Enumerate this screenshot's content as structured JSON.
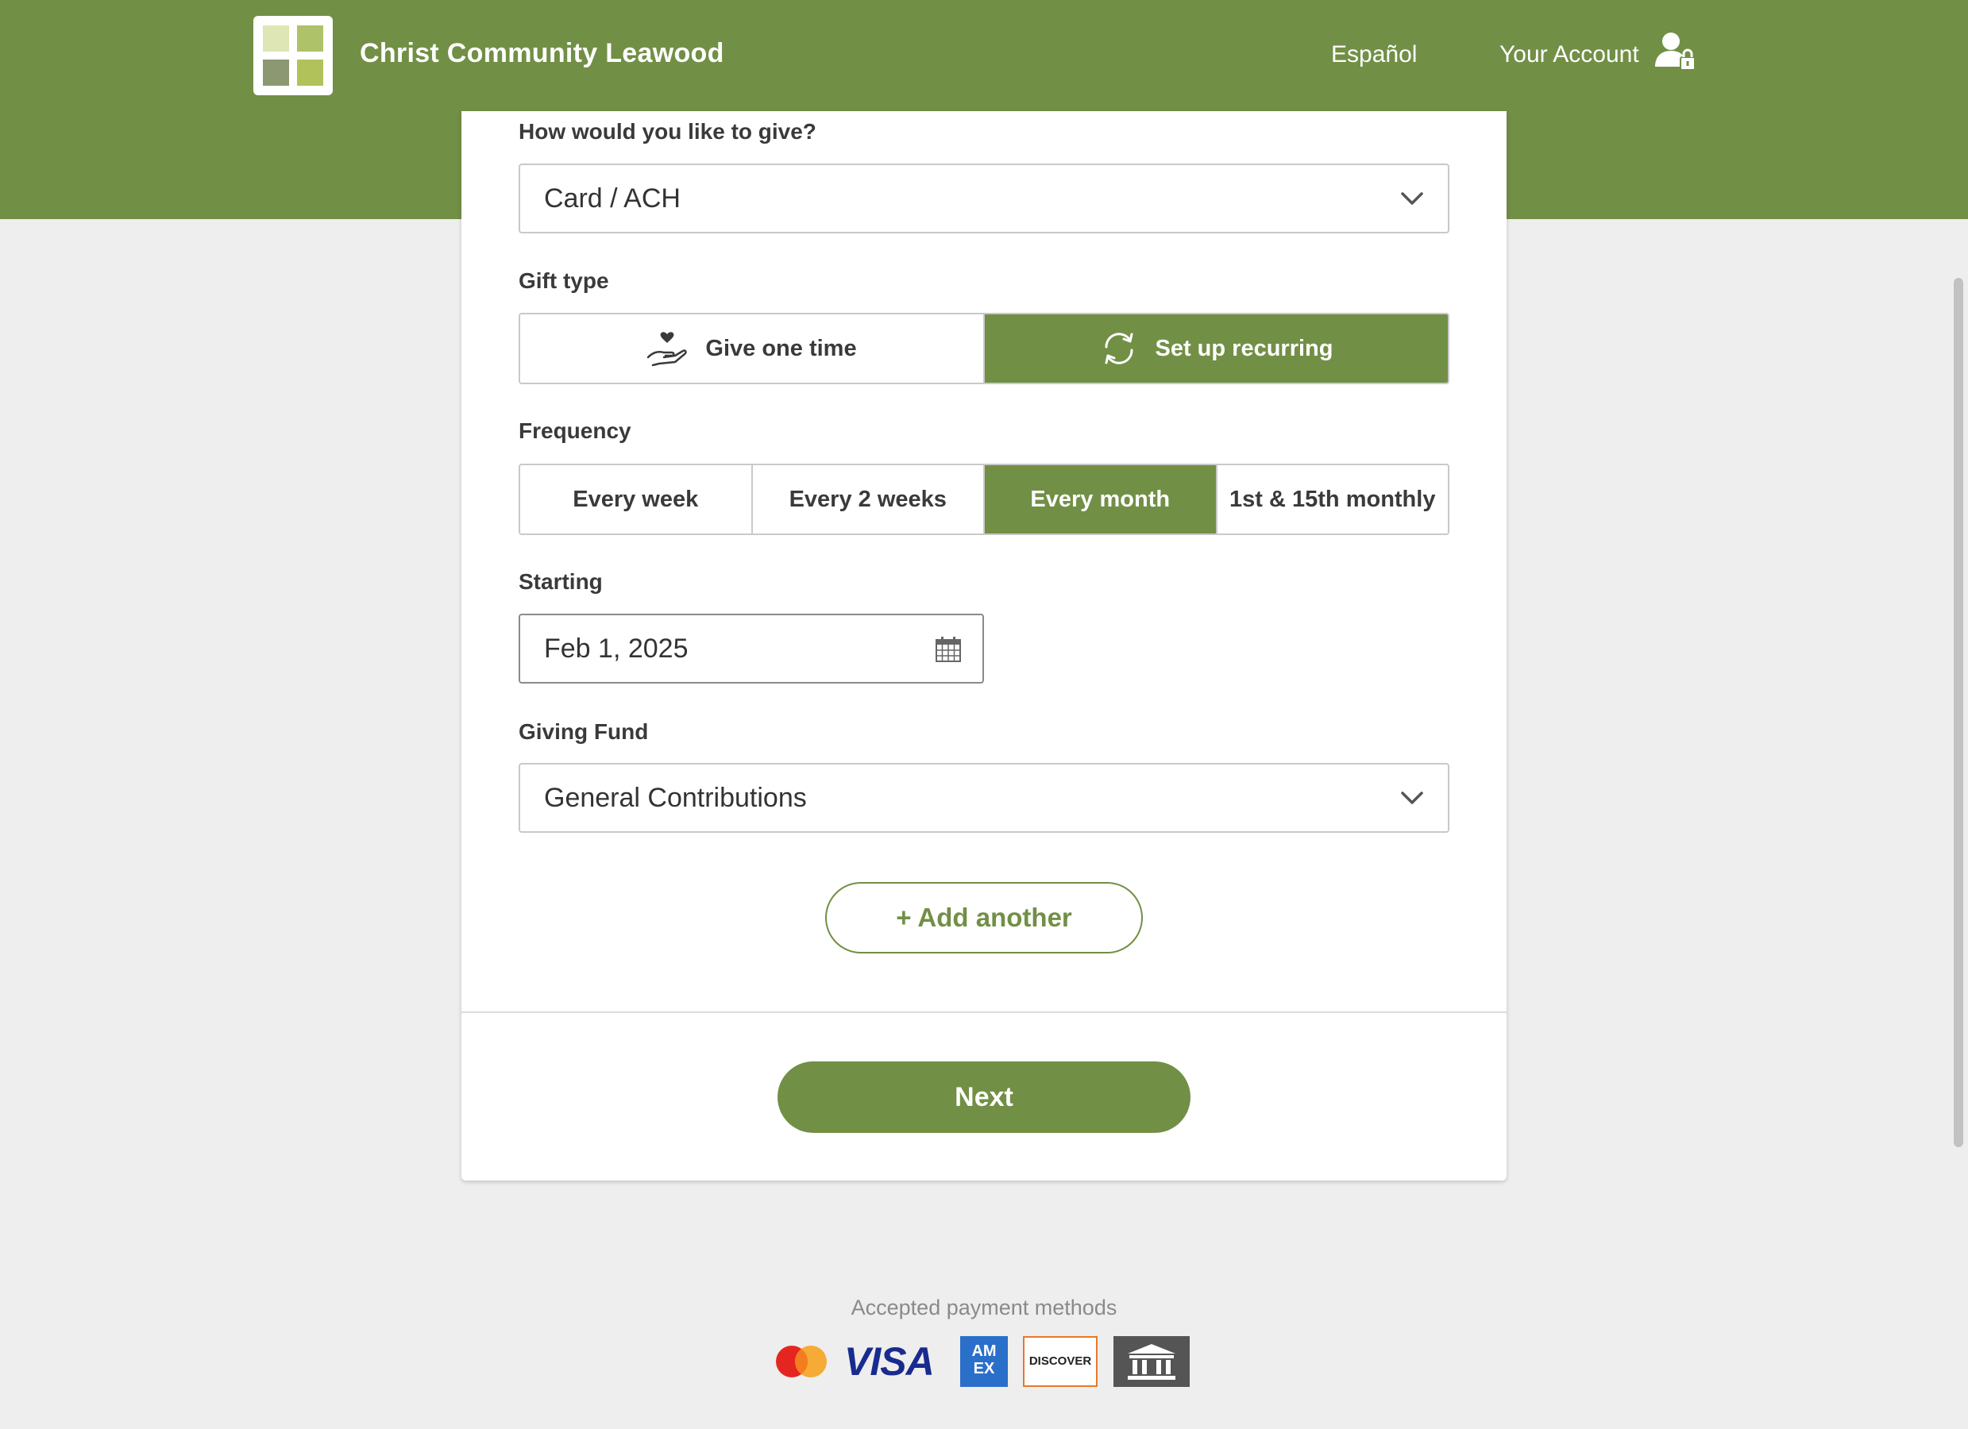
{
  "header": {
    "brand": "Christ Community Leawood",
    "lang_link": "Español",
    "account_link": "Your Account",
    "background_color": "#728f46"
  },
  "form": {
    "give_method": {
      "label": "How would you like to give?",
      "value": "Card / ACH"
    },
    "gift_type": {
      "label": "Gift type",
      "options": [
        "Give one time",
        "Set up recurring"
      ],
      "selected": "Set up recurring"
    },
    "frequency": {
      "label": "Frequency",
      "options": [
        "Every week",
        "Every 2 weeks",
        "Every month",
        "1st & 15th monthly"
      ],
      "selected": "Every month"
    },
    "starting": {
      "label": "Starting",
      "value": "Feb 1, 2025"
    },
    "giving_fund": {
      "label": "Giving Fund",
      "value": "General Contributions"
    },
    "add_another_label": "+ Add another",
    "next_label": "Next"
  },
  "footer": {
    "payment_methods_label": "Accepted payment methods",
    "payment_icons": [
      "mastercard-icon",
      "visa-icon",
      "amex-icon",
      "discover-icon",
      "bank-icon"
    ],
    "visa_text": "VISA",
    "amex_text": "AM EX",
    "discover_text": "DISCOVER"
  },
  "colors": {
    "accent": "#728f46",
    "page_background": "#eeeeee"
  }
}
